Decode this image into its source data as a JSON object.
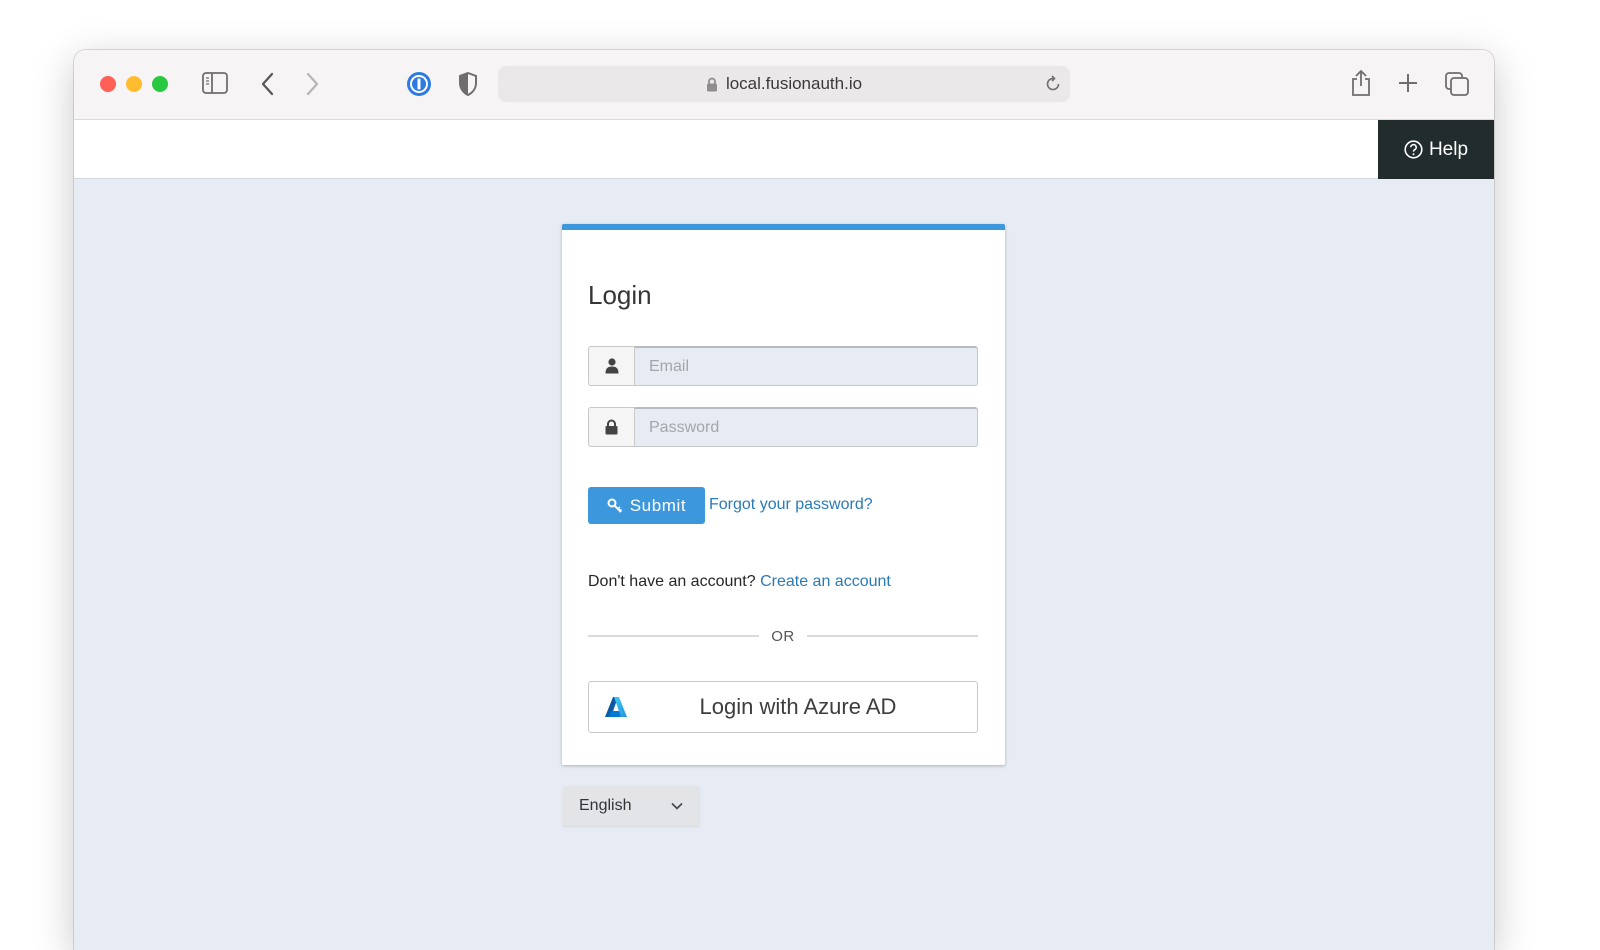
{
  "browser": {
    "url": "local.fusionauth.io",
    "toolbar_icons": [
      "sidebar-icon",
      "back-icon",
      "forward-icon",
      "onepassword-icon",
      "privacy-shield-icon",
      "lock-icon",
      "reload-icon",
      "share-icon",
      "new-tab-icon",
      "tabs-overview-icon"
    ]
  },
  "header": {
    "help_label": "Help",
    "help_icon": "question-circle-icon"
  },
  "login": {
    "title": "Login",
    "email": {
      "placeholder": "Email",
      "value": "",
      "icon": "user-icon"
    },
    "password": {
      "placeholder": "Password",
      "value": "",
      "icon": "lock-icon"
    },
    "submit_label": "Submit",
    "submit_icon": "key-icon",
    "forgot_link": "Forgot your password?",
    "no_account_text": "Don't have an account?",
    "create_account_link": "Create an account",
    "divider_text": "OR",
    "azure_button_label": "Login with Azure AD",
    "azure_icon": "azure-logo-icon"
  },
  "locale": {
    "selected": "English"
  },
  "colors": {
    "accent": "#3c97dc",
    "link": "#2a7ab8",
    "help_bg": "#222c2c",
    "page_bg": "#e7ebf3"
  }
}
